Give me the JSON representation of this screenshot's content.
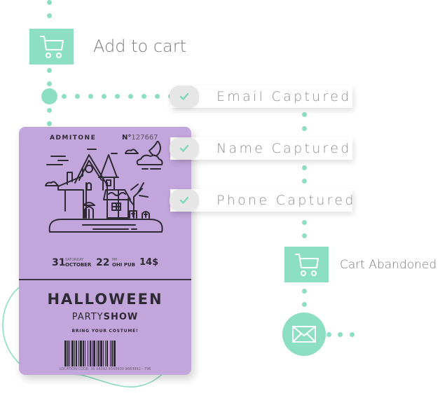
{
  "flow": {
    "accent_color": "#8ddfc3",
    "nodes": {
      "add_to_cart": {
        "label": "Add to cart",
        "icon": "shopping-cart-icon"
      },
      "cart_abandoned": {
        "label": "Cart Abandoned",
        "icon": "shopping-cart-icon"
      },
      "email": {
        "icon": "envelope-icon"
      }
    },
    "captured_steps": [
      {
        "label": "Email Captured",
        "icon": "check-icon"
      },
      {
        "label": "Name Captured",
        "icon": "check-icon"
      },
      {
        "label": "Phone Captured",
        "icon": "check-icon"
      }
    ]
  },
  "ticket": {
    "background_color": "#c2a5db",
    "admit": "ADMITONE",
    "number_prefix": "N°",
    "number": "127667",
    "day": "31",
    "weekday": "SATURDAY",
    "month": "OCTOBER",
    "time": "22",
    "time_suffix": "PM",
    "venue": "OHI PUB",
    "price": "14$",
    "title": "HALLOWEEN",
    "subtitle_light": "PARTY",
    "subtitle_bold": "SHOW",
    "tagline": "BRING YOUR COSTUME!",
    "location_code": "LOCATION CODE: 35 98392 8548930 9683992 - 796"
  }
}
